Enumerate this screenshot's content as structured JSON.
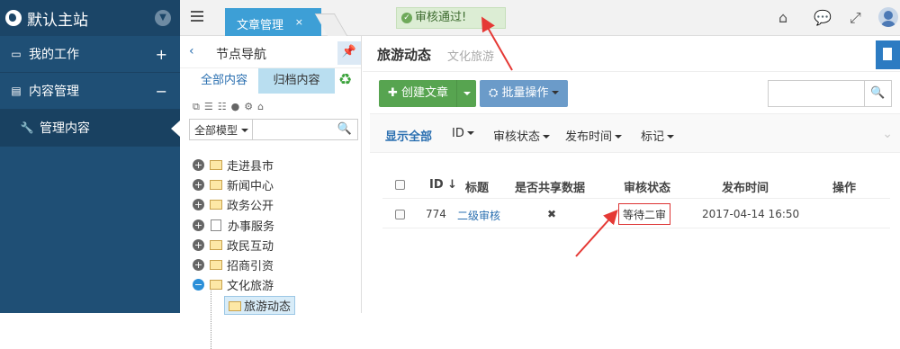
{
  "brand": {
    "title": "默认主站",
    "globe_icon": "globe-icon",
    "chevron_icon": "chevron-down-icon"
  },
  "sidebar": {
    "items": [
      {
        "label": "我的工作",
        "icon": "laptop-icon",
        "toggle": "+"
      },
      {
        "label": "内容管理",
        "icon": "document-icon",
        "toggle": "−"
      },
      {
        "label": "管理内容",
        "icon": "wrench-icon"
      }
    ]
  },
  "topbar": {
    "tab_label": "文章管理",
    "tab_close": "×",
    "toast": "审核通过!"
  },
  "nodepanel": {
    "title": "节点导航",
    "tab_all": "全部内容",
    "tab_archive": "归档内容",
    "model_select": "全部模型",
    "tree": [
      {
        "label": "走进县市"
      },
      {
        "label": "新闻中心"
      },
      {
        "label": "政务公开"
      },
      {
        "label": "办事服务"
      },
      {
        "label": "政民互动"
      },
      {
        "label": "招商引资"
      },
      {
        "label": "文化旅游"
      },
      {
        "label": "旅游动态"
      }
    ]
  },
  "main": {
    "title": "旅游动态",
    "subtitle": "文化旅游",
    "btn_create": "创建文章",
    "btn_batch": "批量操作",
    "filters": {
      "show_all": "显示全部",
      "id": "ID",
      "status": "审核状态",
      "date": "发布时间",
      "mark": "标记"
    },
    "table": {
      "headers": {
        "id": "ID",
        "title": "标题",
        "shared": "是否共享数据",
        "status": "审核状态",
        "date": "发布时间",
        "ops": "操作"
      },
      "rows": [
        {
          "id": "774",
          "title": "二级审核",
          "shared": "✖",
          "status": "等待二审",
          "date": "2017-04-14 16:50"
        }
      ]
    }
  },
  "colors": {
    "sidebar": "#1f4f75",
    "accent": "#3d9fd6",
    "success": "#57a450",
    "annotation": "#e53935"
  }
}
